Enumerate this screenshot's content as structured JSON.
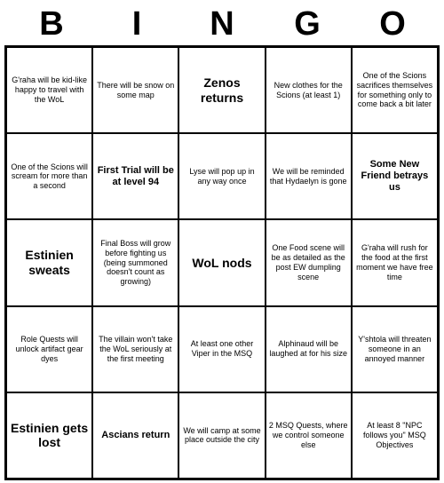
{
  "header": {
    "letters": [
      "B",
      "I",
      "N",
      "G",
      "O"
    ]
  },
  "cells": [
    {
      "text": "G'raha will be kid-like happy to travel with the WoL",
      "size": "small"
    },
    {
      "text": "There will be snow on some map",
      "size": "small"
    },
    {
      "text": "Zenos returns",
      "size": "large"
    },
    {
      "text": "New clothes for the Scions (at least 1)",
      "size": "small"
    },
    {
      "text": "One of the Scions sacrifices themselves for something only to come back a bit later",
      "size": "small"
    },
    {
      "text": "One of the Scions will scream for more than a second",
      "size": "small"
    },
    {
      "text": "First Trial will be at level 94",
      "size": "medium"
    },
    {
      "text": "Lyse will pop up in any way once",
      "size": "small"
    },
    {
      "text": "We will be reminded that Hydaelyn is gone",
      "size": "small"
    },
    {
      "text": "Some New Friend betrays us",
      "size": "medium"
    },
    {
      "text": "Estinien sweats",
      "size": "large"
    },
    {
      "text": "Final Boss will grow before fighting us (being summoned doesn't count as growing)",
      "size": "small"
    },
    {
      "text": "WoL nods",
      "size": "large"
    },
    {
      "text": "One Food scene will be as detailed as the post EW dumpling scene",
      "size": "small"
    },
    {
      "text": "G'raha will rush for the food at the first moment we have free time",
      "size": "small"
    },
    {
      "text": "Role Quests will unlock artifact gear dyes",
      "size": "small"
    },
    {
      "text": "The villain won't take the WoL seriously at the first meeting",
      "size": "small"
    },
    {
      "text": "At least one other Viper in the MSQ",
      "size": "small"
    },
    {
      "text": "Alphinaud will be laughed at for his size",
      "size": "small"
    },
    {
      "text": "Y'shtola will threaten someone in an annoyed manner",
      "size": "small"
    },
    {
      "text": "Estinien gets lost",
      "size": "large"
    },
    {
      "text": "Ascians return",
      "size": "medium"
    },
    {
      "text": "We will camp at some place outside the city",
      "size": "small"
    },
    {
      "text": "2 MSQ Quests, where we control someone else",
      "size": "small"
    },
    {
      "text": "At least 8 \"NPC follows you\" MSQ Objectives",
      "size": "small"
    }
  ]
}
